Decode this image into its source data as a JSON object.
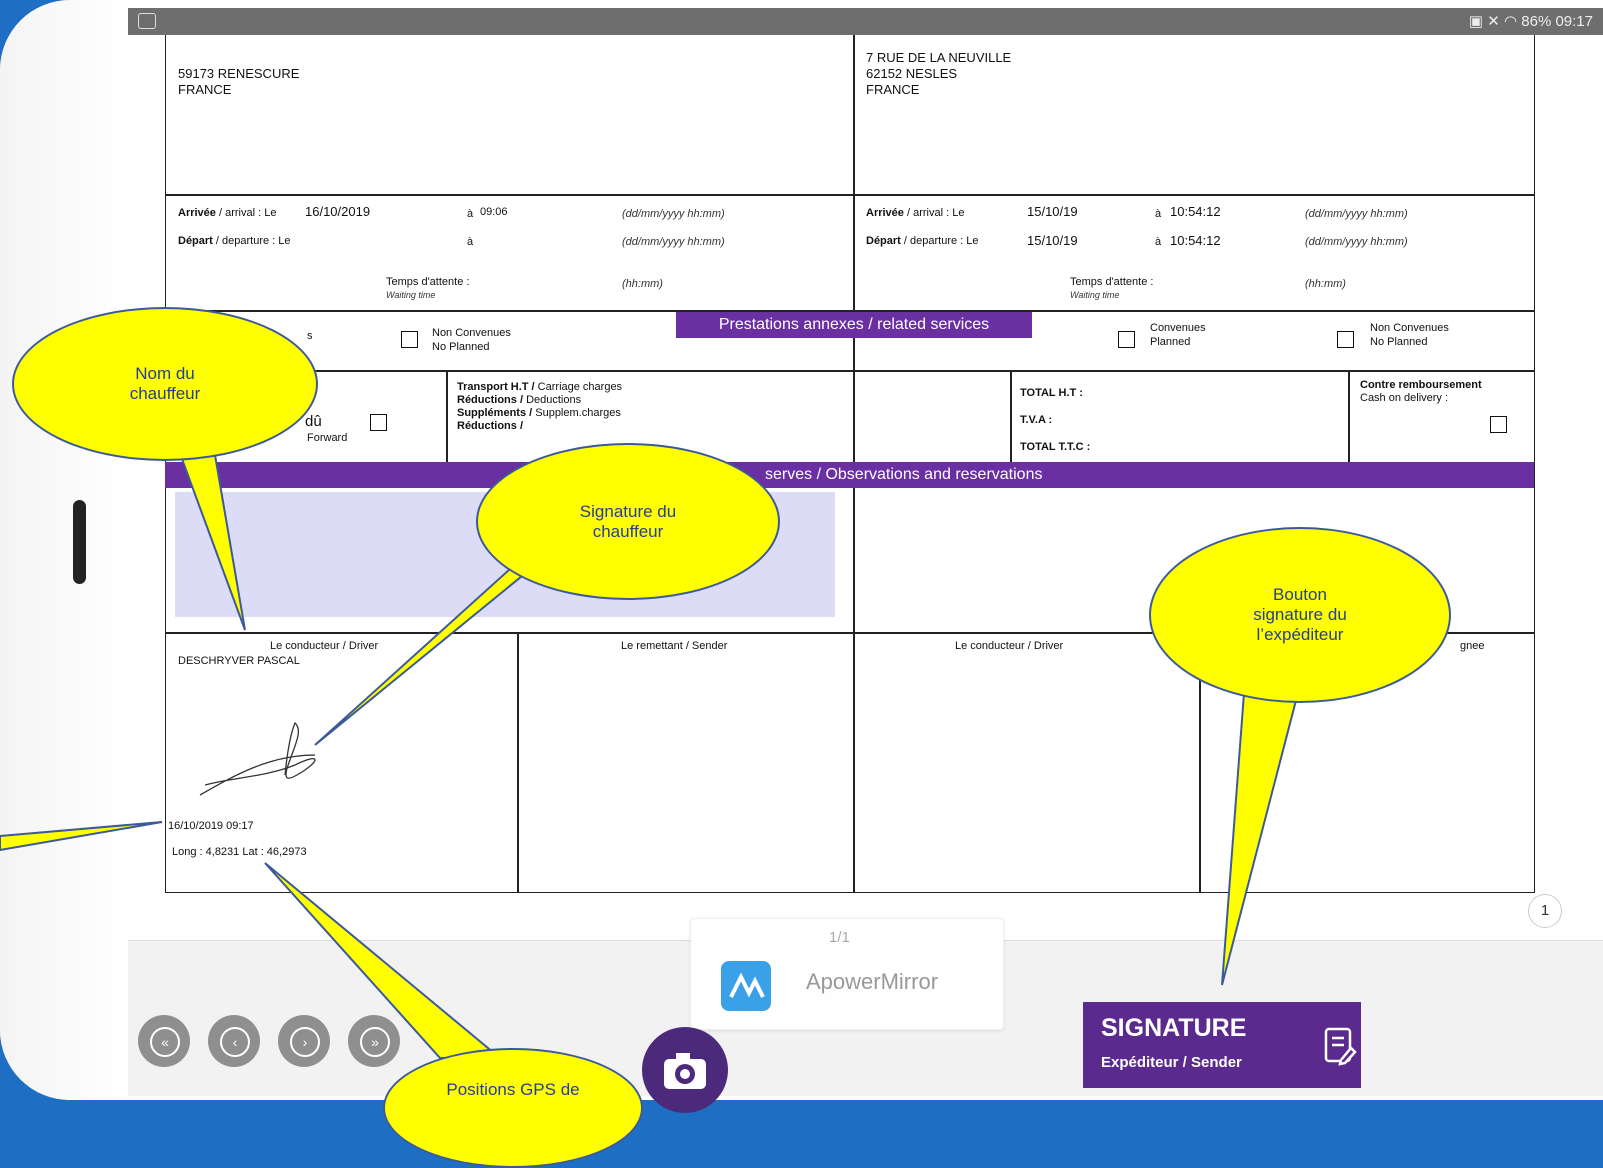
{
  "status_bar": {
    "right_text": "86% 09:17"
  },
  "sender_address": {
    "line1": "59173 RENESCURE",
    "line2": "FRANCE"
  },
  "consignee_address": {
    "line1": "7 RUE DE LA NEUVILLE",
    "line2": "62152 NESLES",
    "line3": "FRANCE"
  },
  "left_times": {
    "arrival_label": "Arrivée",
    "arrival_label_en": " / arrival : Le",
    "arrival_date": "16/10/2019",
    "arrival_at": "à",
    "arrival_time": "09:06",
    "format": "(dd/mm/yyyy hh:mm)",
    "departure_label": "Départ",
    "departure_label_en": " / departure : Le",
    "departure_at": "à",
    "format2": "(dd/mm/yyyy hh:mm)",
    "wait_label": "Temps d'attente :",
    "wait_label_en": "Waiting time",
    "wait_format": "(hh:mm)"
  },
  "right_times": {
    "arrival_label": "Arrivée",
    "arrival_label_en": " / arrival : Le",
    "arrival_date": "15/10/19",
    "arrival_at": "à",
    "arrival_time": "10:54:12",
    "format": "(dd/mm/yyyy hh:mm)",
    "departure_label": "Départ",
    "departure_label_en": " / departure : Le",
    "departure_date": "15/10/19",
    "departure_at": "à",
    "departure_time": "10:54:12",
    "format2": "(dd/mm/yyyy hh:mm)",
    "wait_label": "Temps d'attente :",
    "wait_label_en": "Waiting time",
    "wait_format": "(hh:mm)"
  },
  "services": {
    "band_label": "Prestations annexes / related services",
    "left_partial": "s",
    "left_non_planned": "Non Convenues",
    "left_non_planned_en": "No Planned",
    "right_planned": "Convenues",
    "right_planned_en": "Planned",
    "right_non_planned": "Non Convenues",
    "right_non_planned_en": "No Planned"
  },
  "charges": {
    "du_label": "dû",
    "forward_label": "Forward",
    "transport_label": "Transport H.T /",
    "transport_label_en": " Carriage charges",
    "reductions_label": "Réductions /",
    "reductions_label_en": " Deductions",
    "supplements_label": "Suppléments /",
    "supplements_label_en": " Supplem.charges",
    "reductions2_label": "Réductions /",
    "total_ht": "TOTAL H.T :",
    "tva": "T.V.A :",
    "total_ttc": "TOTAL T.T.C :",
    "cod_label": "Contre remboursement",
    "cod_label_en": "Cash on delivery :"
  },
  "reserves_band": "serves / Observations and reservations",
  "signatures": {
    "driver_label": "Le conducteur / Driver",
    "driver_name": "DESCHRYVER PASCAL",
    "sender_label": "Le remettant / Sender",
    "driver2_label": "Le conducteur / Driver",
    "consignee_partial": "gnee",
    "timestamp": "16/10/2019 09:17",
    "gps": "Long : 4,8231 Lat : 46,2973"
  },
  "page_number": "1",
  "apowermirror": {
    "counter": "1/1",
    "name": "ApowerMirror"
  },
  "signature_button": {
    "title": "SIGNATURE",
    "subtitle": "Expéditeur / Sender"
  },
  "annotations": {
    "driver_name": "Nom du chauffeur",
    "driver_signature": "Signature du chauffeur",
    "sender_button": "Bouton signature du l’expéditeur",
    "gps_positions": "Positions GPS de"
  },
  "colors": {
    "accent_purple": "#6a2fa0",
    "annotation_yellow": "#ffff00",
    "background_blue": "#1e6fc4"
  }
}
